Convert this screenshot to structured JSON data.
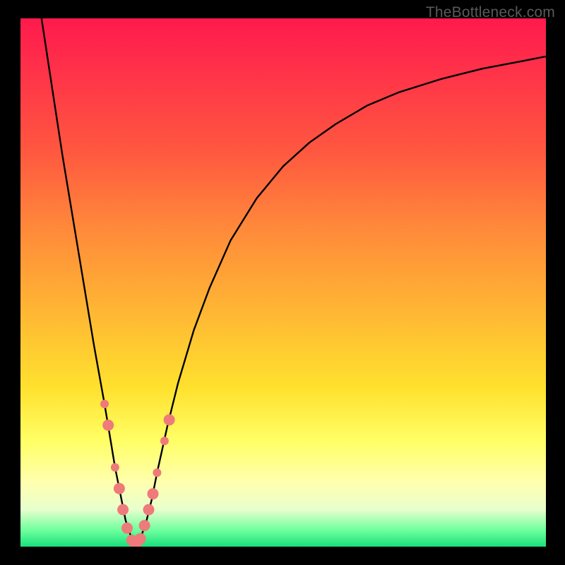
{
  "watermark": "TheBottleneck.com",
  "chart_data": {
    "type": "line",
    "title": "",
    "xlabel": "",
    "ylabel": "",
    "xlim": [
      0,
      100
    ],
    "ylim": [
      0,
      100
    ],
    "series": [
      {
        "name": "bottleneck-curve",
        "x": [
          4,
          6,
          8,
          10,
          12,
          14,
          16,
          17,
          18,
          19,
          20,
          21,
          22,
          23,
          24,
          25,
          26,
          28,
          30,
          33,
          36,
          40,
          45,
          50,
          55,
          60,
          66,
          72,
          80,
          88,
          96,
          100
        ],
        "y": [
          100,
          87,
          74,
          62,
          50,
          38,
          27,
          21,
          15,
          10,
          5,
          2,
          0.5,
          2,
          5,
          9,
          14,
          23,
          31,
          41,
          49,
          58,
          66,
          72,
          76.5,
          80,
          83.5,
          86,
          88.5,
          90.5,
          92,
          92.8
        ]
      }
    ],
    "markers": {
      "name": "highlighted-points",
      "color": "#ef7a7a",
      "points": [
        {
          "x": 16.0,
          "y": 27,
          "r": 6
        },
        {
          "x": 16.7,
          "y": 23,
          "r": 8
        },
        {
          "x": 18.0,
          "y": 15,
          "r": 6
        },
        {
          "x": 18.8,
          "y": 11,
          "r": 8
        },
        {
          "x": 19.5,
          "y": 7,
          "r": 8
        },
        {
          "x": 20.3,
          "y": 3.5,
          "r": 8
        },
        {
          "x": 21.2,
          "y": 1.2,
          "r": 8
        },
        {
          "x": 22.0,
          "y": 0.5,
          "r": 8
        },
        {
          "x": 22.8,
          "y": 1.5,
          "r": 8
        },
        {
          "x": 23.6,
          "y": 4,
          "r": 8
        },
        {
          "x": 24.4,
          "y": 7,
          "r": 8
        },
        {
          "x": 25.2,
          "y": 10,
          "r": 8
        },
        {
          "x": 26.0,
          "y": 14,
          "r": 6
        },
        {
          "x": 27.4,
          "y": 20,
          "r": 6
        },
        {
          "x": 28.3,
          "y": 24,
          "r": 8
        }
      ]
    },
    "colors": {
      "curve": "#000000",
      "marker": "#ef7a7a",
      "background_top": "#ff1a4d",
      "background_bottom": "#18e07a"
    }
  }
}
